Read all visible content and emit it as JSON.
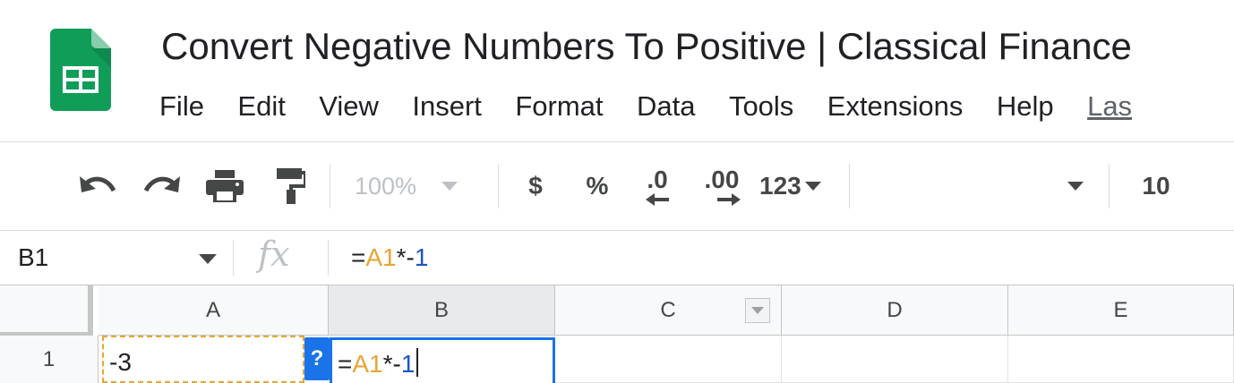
{
  "app": {
    "document_title": "Convert Negative Numbers To Positive | Classical Finance"
  },
  "menu": {
    "items": [
      "File",
      "Edit",
      "View",
      "Insert",
      "Format",
      "Data",
      "Tools",
      "Extensions",
      "Help"
    ],
    "last_edit_label": "Las"
  },
  "toolbar": {
    "undo_icon": "undo-icon",
    "redo_icon": "redo-icon",
    "print_icon": "print-icon",
    "paint_format_icon": "paint-format-icon",
    "zoom": "100%",
    "currency": "$",
    "percent": "%",
    "decrease_decimal": ".0",
    "increase_decimal": ".00",
    "number_format": "123",
    "font_size": "10"
  },
  "formula_bar": {
    "name_box": "B1",
    "fx_label": "fx",
    "formula": {
      "prefix": "=",
      "ref": "A1",
      "operator": "*-",
      "number": "1"
    }
  },
  "grid": {
    "columns": [
      "A",
      "B",
      "C",
      "D",
      "E"
    ],
    "rows": [
      "1"
    ],
    "cells": {
      "A1": "-3"
    },
    "help_badge": "?",
    "editor": {
      "prefix": "=",
      "ref": "A1",
      "operator": "*-",
      "number": "1"
    }
  },
  "colors": {
    "accent": "#1a73e8",
    "reference": "#e8a434",
    "number": "#1a56c4",
    "logo_green": "#0f9d58"
  }
}
